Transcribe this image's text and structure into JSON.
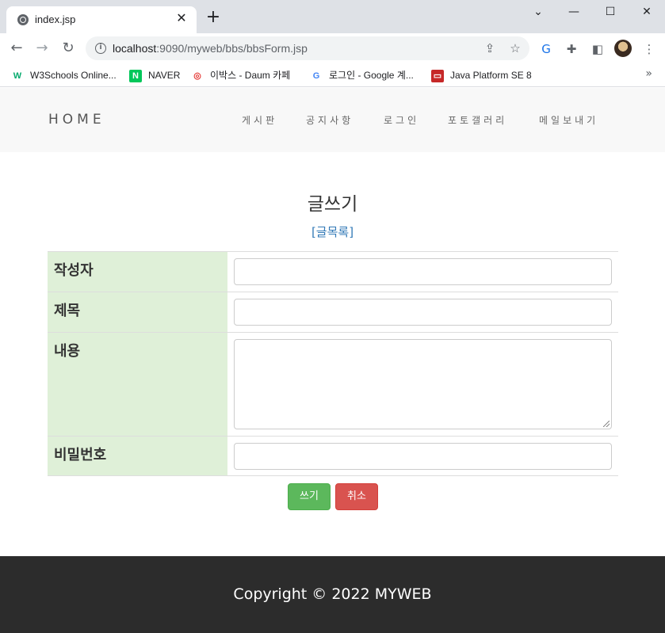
{
  "browser": {
    "tab_title": "index.jsp",
    "tab_close": "✕",
    "new_tab": "+",
    "window_controls": {
      "minimize": "—",
      "maximize": "☐",
      "close": "✕",
      "dropdown": "⌄"
    },
    "url_host": "localhost",
    "url_rest": ":9090/myweb/bbs/bbsForm.jsp",
    "bookmarks": [
      {
        "label": "W3Schools Online...",
        "icon_glyph": "W",
        "icon_color": "#04aa6d"
      },
      {
        "label": "NAVER",
        "icon_glyph": "N",
        "icon_color": "#03c75a"
      },
      {
        "label": "이박스 - Daum 카페",
        "icon_glyph": "◎",
        "icon_color": "#e53935"
      },
      {
        "label": "로그인 - Google 계...",
        "icon_glyph": "G",
        "icon_color": "#4285f4"
      },
      {
        "label": "Java Platform SE 8",
        "icon_glyph": "▭",
        "icon_color": "#c62828"
      }
    ],
    "bookmarks_more": "»"
  },
  "site": {
    "brand": "HOME",
    "menu": [
      "게시판",
      "공지사항",
      "로그인",
      "포토갤러리",
      "메일보내기"
    ]
  },
  "form": {
    "title": "글쓰기",
    "list_link": "[글목록]",
    "fields": {
      "writer_label": "작성자",
      "subject_label": "제목",
      "content_label": "내용",
      "password_label": "비밀번호"
    },
    "submit_label": "쓰기",
    "cancel_label": "취소"
  },
  "footer": {
    "copyright": "Copyright © 2022 MYWEB"
  },
  "colors": {
    "label_bg": "#dff0d8",
    "submit_bg": "#5cb85c",
    "cancel_bg": "#d9534f",
    "footer_bg": "#2c2c2c",
    "link": "#337ab7"
  }
}
